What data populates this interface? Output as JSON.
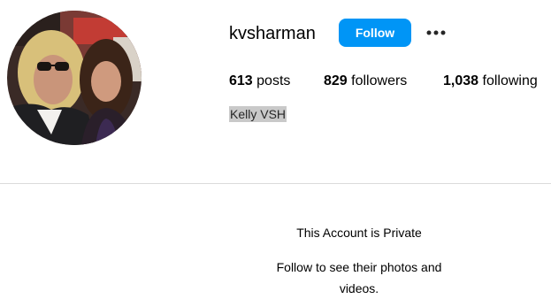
{
  "profile": {
    "username": "kvsharman",
    "full_name": "Kelly VSH",
    "avatar_icon": "profile-photo",
    "follow_label": "Follow",
    "more_icon": "more-options-icon",
    "accent_color": "#0095f6"
  },
  "stats": {
    "posts_count": "613",
    "posts_label": "posts",
    "followers_count": "829",
    "followers_label": "followers",
    "following_count": "1,038",
    "following_label": "following"
  },
  "private_notice": {
    "title": "This Account is Private",
    "subtitle": "Follow to see their photos and videos."
  }
}
